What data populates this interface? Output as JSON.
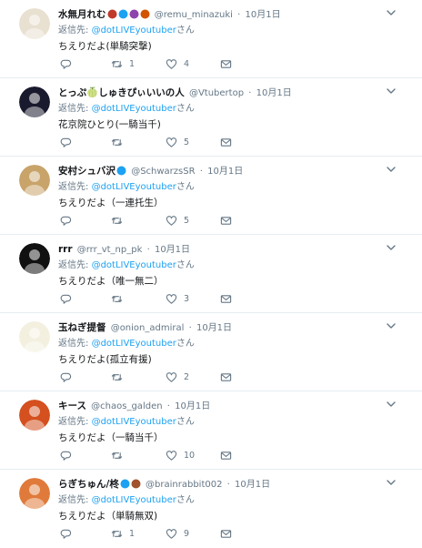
{
  "reply_prefix": "返信先:",
  "reply_suffix": "さん",
  "tweets": [
    {
      "name": "水無月れむ",
      "handle": "@remu_minazuki",
      "time": "10月1日",
      "mention": "@dotLIVEyoutuber",
      "text": "ちえりだよ(単騎突撃)",
      "replies": "",
      "retweets": "1",
      "likes": "4",
      "avatar_color": "#e8e0d0",
      "emojis": [
        "#c0392b",
        "#1da1f2",
        "#8e44ad",
        "#d35400"
      ]
    },
    {
      "name": "とっぷ🍈しゅきぴぃいいの人",
      "handle": "@Vtubertop",
      "time": "10月1日",
      "mention": "@dotLIVEyoutuber",
      "text": "花京院ひとり(一騎当千)",
      "replies": "",
      "retweets": "",
      "likes": "5",
      "avatar_color": "#1a1a2e",
      "emojis": []
    },
    {
      "name": "安村シュバ沢",
      "handle": "@SchwarzsSR",
      "time": "10月1日",
      "mention": "@dotLIVEyoutuber",
      "text": "ちえりだよ（一連托生）",
      "replies": "",
      "retweets": "",
      "likes": "5",
      "avatar_color": "#c8a46a",
      "emojis": [
        "#1da1f2"
      ]
    },
    {
      "name": "rrr",
      "handle": "@rrr_vt_np_pk",
      "time": "10月1日",
      "mention": "@dotLIVEyoutuber",
      "text": "ちえりだよ（唯一無二）",
      "replies": "",
      "retweets": "",
      "likes": "3",
      "avatar_color": "#111111",
      "emojis": []
    },
    {
      "name": "玉ねぎ提督",
      "handle": "@onion_admiral",
      "time": "10月1日",
      "mention": "@dotLIVEyoutuber",
      "text": "ちえりだよ(孤立有援)",
      "replies": "",
      "retweets": "",
      "likes": "2",
      "avatar_color": "#f3f0e0",
      "emojis": []
    },
    {
      "name": "キース",
      "handle": "@chaos_galden",
      "time": "10月1日",
      "mention": "@dotLIVEyoutuber",
      "text": "ちえりだよ（一騎当千）",
      "replies": "",
      "retweets": "",
      "likes": "10",
      "avatar_color": "#d4501f",
      "emojis": []
    },
    {
      "name": "らぎちゅん/柊",
      "handle": "@brainrabbit002",
      "time": "10月1日",
      "mention": "@dotLIVEyoutuber",
      "text": "ちえりだよ（単騎無双)",
      "replies": "",
      "retweets": "1",
      "likes": "9",
      "avatar_color": "#e07a3a",
      "emojis": [
        "#1da1f2",
        "#a0522d"
      ]
    }
  ],
  "icons": {
    "reply": "reply-icon",
    "retweet": "retweet-icon",
    "like": "heart-icon",
    "dm": "envelope-icon",
    "more": "chevron-down-icon"
  },
  "colors": {
    "muted": "#657786",
    "link": "#1da1f2",
    "divider": "#e6ecf0"
  }
}
